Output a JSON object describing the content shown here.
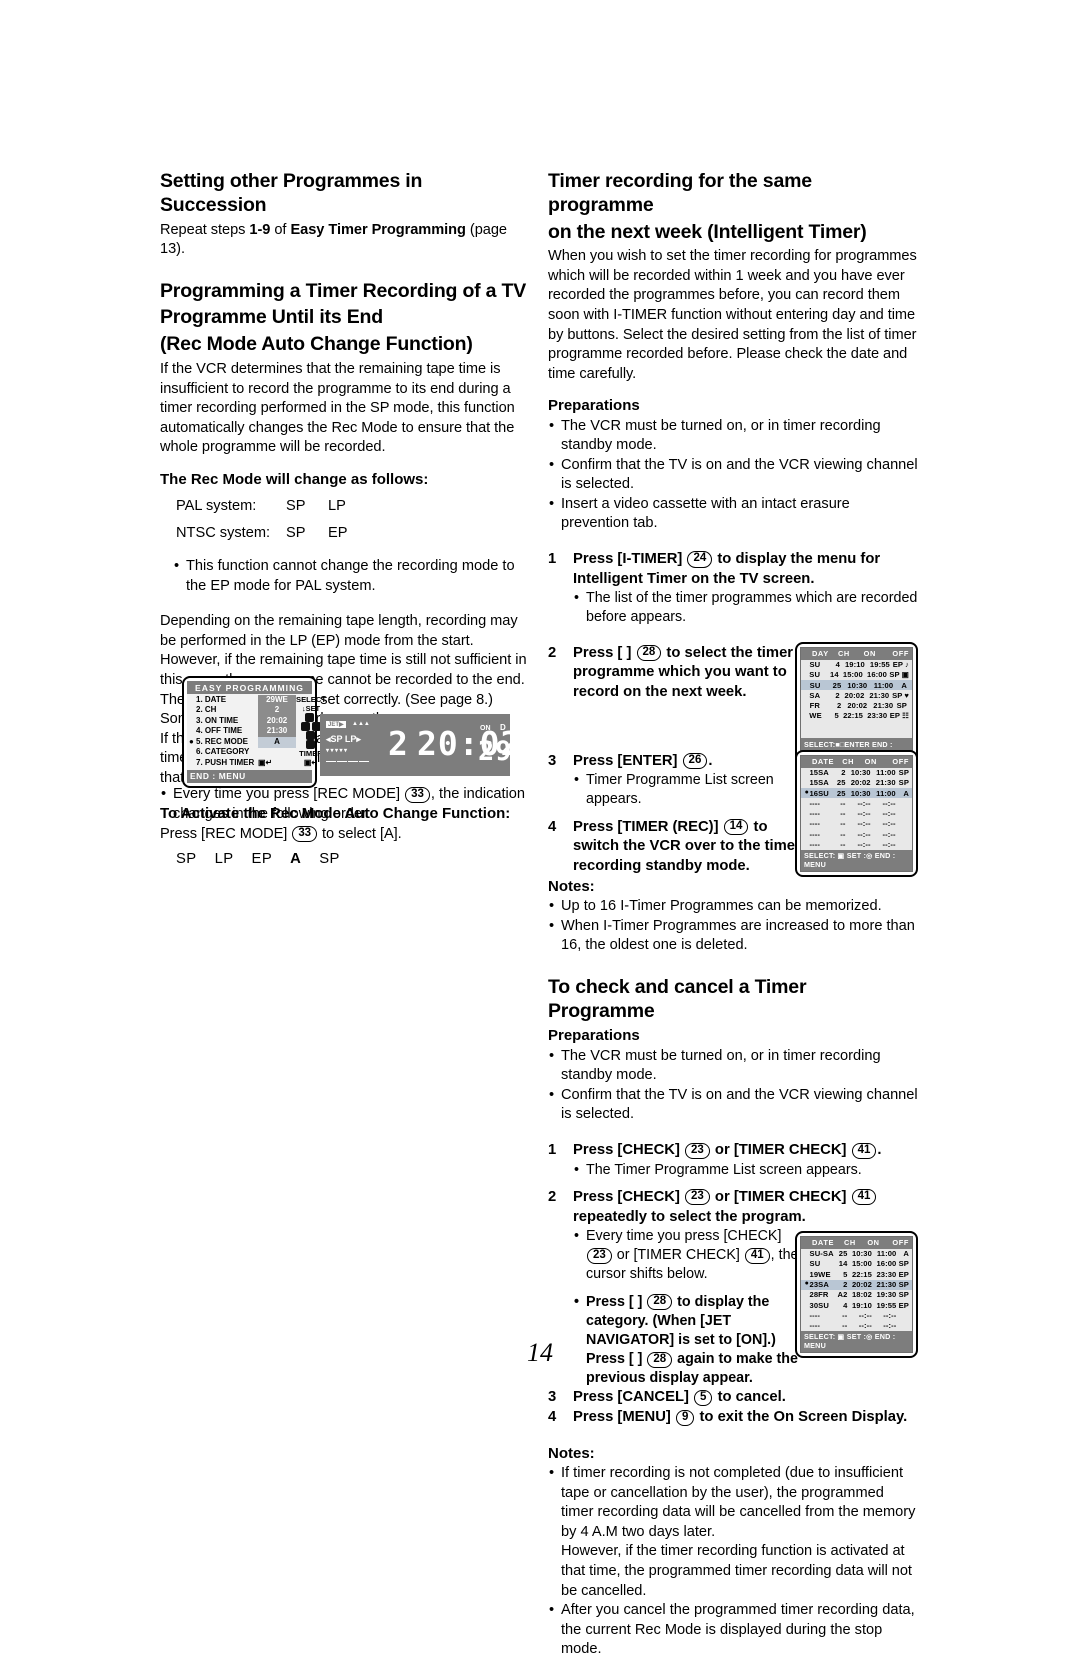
{
  "page_number": "14",
  "left": {
    "h1a": "Setting other Programmes in Succession",
    "repeat_pre": "Repeat steps ",
    "repeat_steps": "1-9",
    "repeat_mid": " of ",
    "repeat_bold": "Easy Timer Programming",
    "repeat_post": " (page 13).",
    "h1b_line1": "Programming a Timer Recording of a TV",
    "h1b_line2": "Programme Until its End",
    "h1b_line3": "(Rec Mode Auto Change Function)",
    "intro": "If the VCR determines that the remaining tape time is insufficient to record the programme to its end during a timer recording performed in the SP mode, this function automatically changes the Rec Mode to ensure that the whole programme will be recorded.",
    "rec_mode_head": "The Rec Mode will change as follows:",
    "modes": [
      {
        "label": "PAL system:",
        "from": "SP",
        "to": "LP"
      },
      {
        "label": "NTSC system:",
        "from": "SP",
        "to": "EP"
      }
    ],
    "bullet_pal": "This function cannot change the recording mode to the EP mode for PAL system.",
    "para2": "Depending on the remaining tape length, recording may be performed in the LP (EP) mode from the start. However, if the remaining tape time is still not sufficient in this case, the programme cannot be recorded to the end.",
    "para3": "The tape length must be set correctly. (See page 8.)",
    "para4": "Some tapes may not work correctly.",
    "para5": "If the recording mode changes from SP to LP during a timer recording, some brief picture distortion occurs at that point.",
    "activate_head": "To Activate the Rec Mode Auto Change Function:",
    "activate_pre": "Press [REC MODE] ",
    "activate_key": "33",
    "activate_post": " to select [A].",
    "every_time_pre": "Every time you press [REC MODE] ",
    "every_time_key": "33",
    "every_time_post": ", the indication changes in the following order:",
    "sequence": [
      "SP",
      "LP",
      "EP",
      "A",
      "SP"
    ]
  },
  "easy_osd": {
    "title": "EASY PROGRAMMING",
    "rows": [
      {
        "cursor": "",
        "name": "1. DATE",
        "value": "29WE",
        "state": "dark"
      },
      {
        "cursor": "",
        "name": "2. CH",
        "value": "2",
        "state": "dark"
      },
      {
        "cursor": "",
        "name": "3. ON TIME",
        "value": "20:02",
        "state": "dark"
      },
      {
        "cursor": "",
        "name": "4. OFF TIME",
        "value": "21:30",
        "state": "dark"
      },
      {
        "cursor": "●",
        "name": "5. REC MODE",
        "value": "A",
        "state": "sel"
      },
      {
        "cursor": "",
        "name": "6. CATEGORY",
        "value": "",
        "state": "blank"
      },
      {
        "cursor": "",
        "name": "7. PUSH TIMER",
        "value": "",
        "state": "none"
      }
    ],
    "side_select": "SELECT",
    "side_set": "SET",
    "side_timer": "TIMER",
    "footer": "END : MENU"
  },
  "vfd": {
    "mode_label": "SP LP",
    "channel": "2",
    "time": "20:02",
    "date": "29",
    "on_label": "ON",
    "d_label": "D",
    "tape_bar": "————"
  },
  "right": {
    "h1a_line1": "Timer recording for the same programme",
    "h1a_line2": "on the next week (Intelligent Timer)",
    "intro": "When you wish to set the timer recording for programmes which will be recorded within 1 week and you have ever recorded the programmes before, you can record them soon with I-TIMER function without entering day and time by buttons. Select the desired setting from the list of timer programme recorded before. Please check the date and time carefully.",
    "prep_head": "Preparations",
    "prep_items": [
      "The VCR must be turned on, or in timer recording standby mode.",
      "Confirm that the TV is on and the VCR viewing channel is selected.",
      "Insert a video cassette with an intact erasure prevention tab."
    ],
    "step1_num": "1",
    "step1_a": "Press [I-TIMER] ",
    "step1_key": "24",
    "step1_b": " to display the menu for Intelligent Timer on the TV screen.",
    "step1_sub": "The list of the timer programmes which are recorded before appears.",
    "step2_num": "2",
    "step2_a": "Press [       ] ",
    "step2_key": "28",
    "step2_b": " to select the timer programme which you want to record on the next week.",
    "step3_num": "3",
    "step3_a": "Press [ENTER] ",
    "step3_key": "26",
    "step3_b": ".",
    "step3_sub": "Timer Programme List screen appears.",
    "step4_num": "4",
    "step4_a": "Press [TIMER (REC)] ",
    "step4_key": "14",
    "step4_b": " to switch the VCR over to the timer recording standby mode.",
    "notes_head": "Notes:",
    "notes": [
      "Up to 16 I-Timer Programmes can be memorized.",
      "When I-Timer Programmes are increased to more than 16, the oldest one is deleted."
    ],
    "h1b": "To check and cancel a Timer Programme",
    "prep2_head": "Preparations",
    "prep2_items": [
      "The VCR must be turned on, or in timer recording standby mode.",
      "Confirm that the TV is on and the VCR viewing channel is selected."
    ],
    "c1_num": "1",
    "c1_a": "Press [CHECK] ",
    "c1_key1": "23",
    "c1_b": " or [TIMER CHECK] ",
    "c1_key2": "41",
    "c1_c": ".",
    "c1_sub": "The Timer Programme List screen appears.",
    "c2_num": "2",
    "c2_a": "Press [CHECK] ",
    "c2_key1": "23",
    "c2_b": " or [TIMER CHECK] ",
    "c2_key2": "41",
    "c2_c": " repeatedly to select the program.",
    "c2_sub1_a": "Every time you press [CHECK] ",
    "c2_sub1_key1": "23",
    "c2_sub1_b": " or [TIMER CHECK] ",
    "c2_sub1_key2": "41",
    "c2_sub1_c": ", the cursor shifts below.",
    "c2_sub2_a": "Press  [    ] ",
    "c2_sub2_key1": "28",
    "c2_sub2_b": " to display the category. (When [JET NAVIGATOR] is set to [ON].) Press  [    ] ",
    "c2_sub2_key2": "28",
    "c2_sub2_c": " again to make the previous display appear.",
    "c3_num": "3",
    "c3_a": "Press [CANCEL] ",
    "c3_key": "5",
    "c3_b": " to cancel.",
    "c4_num": "4",
    "c4_a": "Press [MENU] ",
    "c4_key": "9",
    "c4_b": " to exit the On Screen Display.",
    "notes2_head": "Notes:",
    "notes2": [
      "If timer recording is not completed (due to insufficient tape or cancellation by the user), the programmed timer recording data will be cancelled from the memory by 4 A.M two days later.",
      "After you cancel the programmed timer recording data, the current Rec Mode is displayed during the stop mode."
    ],
    "notes2_extra": "However, if the timer recording function is activated at that time, the programmed timer recording data will not be cancelled."
  },
  "osd_itimer": {
    "headers": [
      "DAY",
      "CH",
      "ON",
      "OFF"
    ],
    "rows": [
      {
        "cursor": "",
        "day": "SU",
        "ch": "4",
        "on": "19:10",
        "off": "19:55",
        "mode": "EP",
        "icon": "♪",
        "sel": false
      },
      {
        "cursor": "",
        "day": "SU",
        "ch": "14",
        "on": "15:00",
        "off": "16:00",
        "mode": "SP",
        "icon": "▣",
        "sel": false
      },
      {
        "cursor": "",
        "day": "SU",
        "ch": "25",
        "on": "10:30",
        "off": "11:00",
        "mode": "A",
        "icon": "",
        "sel": true
      },
      {
        "cursor": "",
        "day": "SA",
        "ch": "2",
        "on": "20:02",
        "off": "21:30",
        "mode": "SP",
        "icon": "♥",
        "sel": false
      },
      {
        "cursor": "",
        "day": "FR",
        "ch": "2",
        "on": "20:02",
        "off": "21:30",
        "mode": "SP",
        "icon": "",
        "sel": false
      },
      {
        "cursor": "",
        "day": "WE",
        "ch": "5",
        "on": "22:15",
        "off": "23:30",
        "mode": "EP",
        "icon": "☷",
        "sel": false
      }
    ],
    "footer": "SELECT:■□ENTER   END : MENU"
  },
  "osd_list": {
    "headers": [
      "DATE",
      "CH",
      "ON",
      "OFF"
    ],
    "rows": [
      {
        "cursor": "",
        "date": "15SA",
        "ch": "2",
        "on": "10:30",
        "off": "11:00",
        "mode": "SP",
        "sel": false
      },
      {
        "cursor": "",
        "date": "15SA",
        "ch": "25",
        "on": "20:02",
        "off": "21:30",
        "mode": "SP",
        "sel": false
      },
      {
        "cursor": "●",
        "date": "16SU",
        "ch": "25",
        "on": "10:30",
        "off": "11:00",
        "mode": "A",
        "sel": true
      },
      {
        "cursor": "",
        "date": "----",
        "ch": "--",
        "on": "--:--",
        "off": "--:--",
        "mode": "",
        "sel": false
      },
      {
        "cursor": "",
        "date": "----",
        "ch": "--",
        "on": "--:--",
        "off": "--:--",
        "mode": "",
        "sel": false
      },
      {
        "cursor": "",
        "date": "----",
        "ch": "--",
        "on": "--:--",
        "off": "--:--",
        "mode": "",
        "sel": false
      },
      {
        "cursor": "",
        "date": "----",
        "ch": "--",
        "on": "--:--",
        "off": "--:--",
        "mode": "",
        "sel": false
      },
      {
        "cursor": "",
        "date": "----",
        "ch": "--",
        "on": "--:--",
        "off": "--:--",
        "mode": "",
        "sel": false
      }
    ],
    "footer": "SELECT: ▣   SET :◎  END : MENU"
  },
  "osd_check": {
    "headers": [
      "DATE",
      "CH",
      "ON",
      "OFF"
    ],
    "rows": [
      {
        "cursor": "",
        "date": "SU-SA",
        "ch": "25",
        "on": "10:30",
        "off": "11:00",
        "mode": "A",
        "sel": false
      },
      {
        "cursor": "",
        "date": "SU",
        "ch": "14",
        "on": "15:00",
        "off": "16:00",
        "mode": "SP",
        "sel": false
      },
      {
        "cursor": "",
        "date": "19WE",
        "ch": "5",
        "on": "22:15",
        "off": "23:30",
        "mode": "EP",
        "sel": false
      },
      {
        "cursor": "●",
        "date": "23SA",
        "ch": "2",
        "on": "20:02",
        "off": "21:30",
        "mode": "SP",
        "sel": true
      },
      {
        "cursor": "",
        "date": "28FR",
        "ch": "A2",
        "on": "18:02",
        "off": "19:30",
        "mode": "SP",
        "sel": false
      },
      {
        "cursor": "",
        "date": "30SU",
        "ch": "4",
        "on": "19:10",
        "off": "19:55",
        "mode": "EP",
        "sel": false
      },
      {
        "cursor": "",
        "date": "----",
        "ch": "--",
        "on": "--:--",
        "off": "--:--",
        "mode": "",
        "sel": false
      },
      {
        "cursor": "",
        "date": "----",
        "ch": "--",
        "on": "--:--",
        "off": "--:--",
        "mode": "",
        "sel": false
      }
    ],
    "footer": "SELECT: ▣   SET :◎  END : MENU"
  }
}
